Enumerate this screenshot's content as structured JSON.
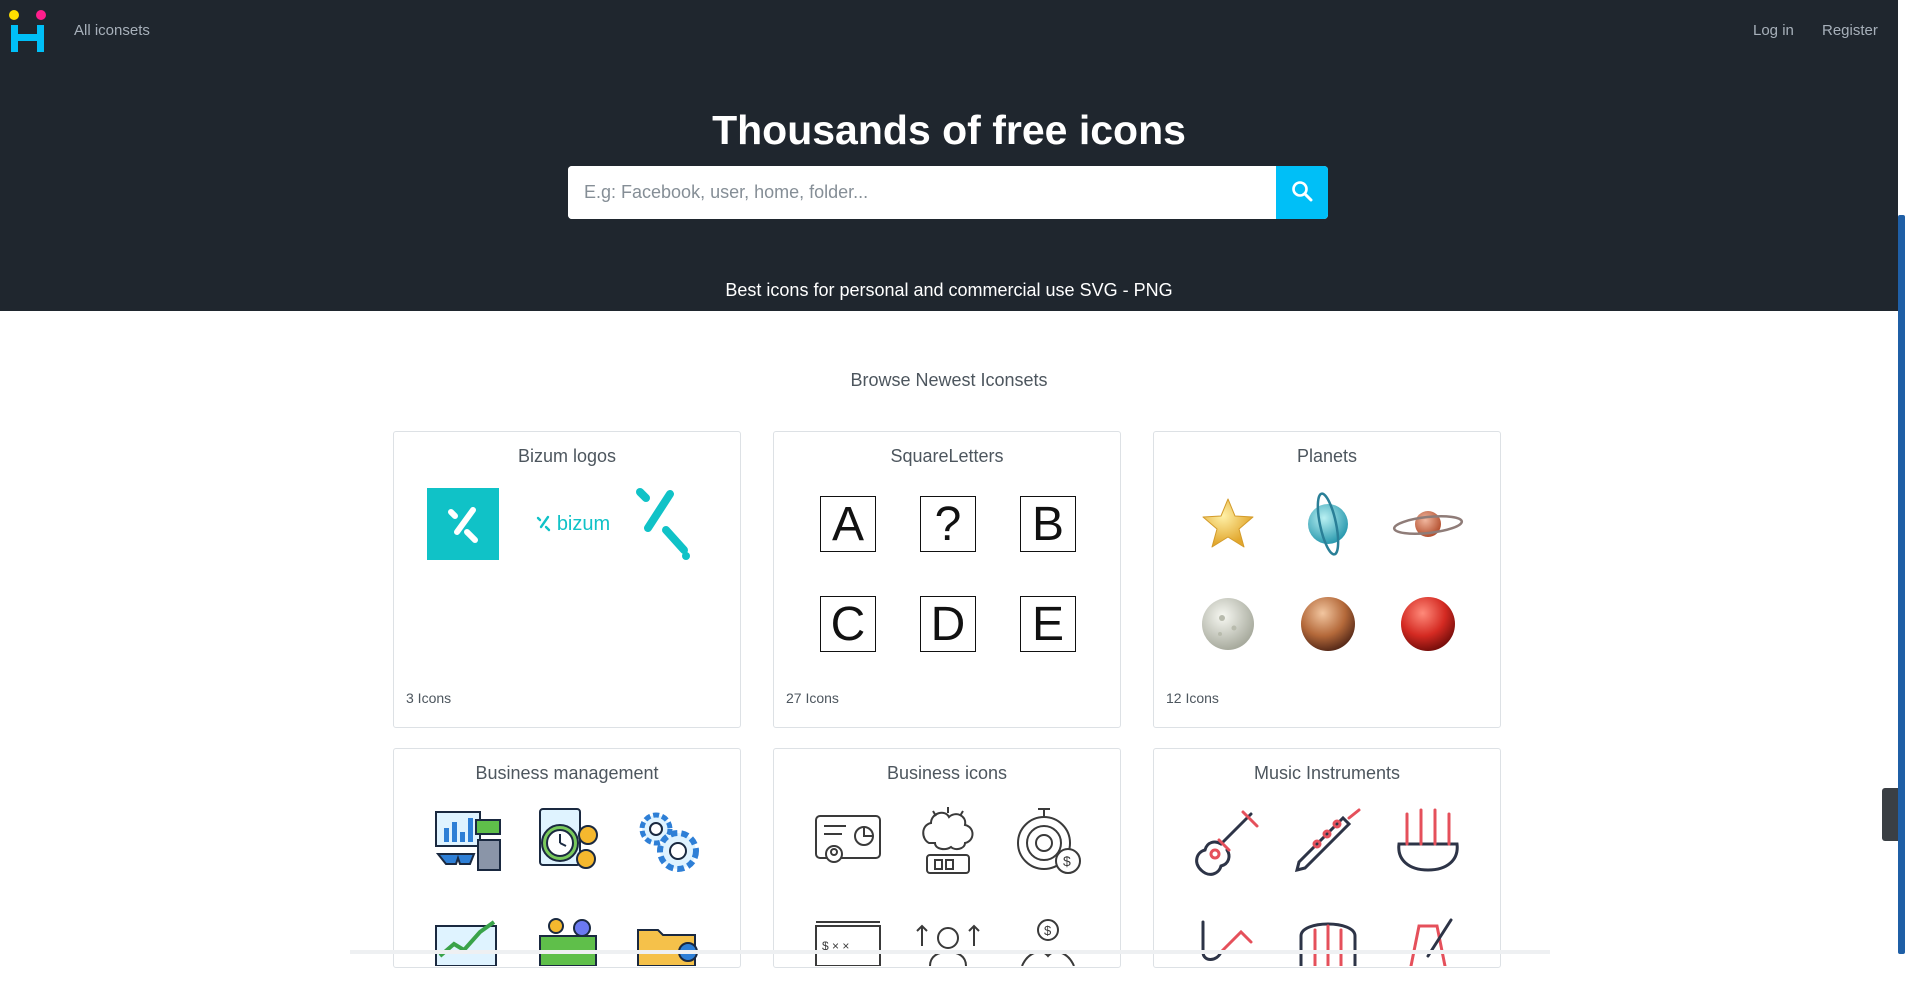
{
  "nav": {
    "all_iconsets": "All iconsets",
    "login": "Log in",
    "register": "Register",
    "logo_icon": "brand-logo-icon"
  },
  "hero": {
    "title": "Thousands of free icons",
    "search_placeholder": "E.g: Facebook, user, home, folder...",
    "search_icon": "search-icon",
    "subtitle": "Best icons for personal and commercial use SVG - PNG"
  },
  "section_title": "Browse Newest Iconsets",
  "iconsets": [
    {
      "title": "Bizum logos",
      "count": "3 Icons",
      "icons": [
        "bizum-square-icon",
        "bizum-wordmark-icon",
        "bizum-mark-icon"
      ],
      "wordmark_text": "bizum"
    },
    {
      "title": "SquareLetters",
      "count": "27 Icons",
      "letters": [
        "A",
        "?",
        "B",
        "C",
        "D",
        "E"
      ]
    },
    {
      "title": "Planets",
      "count": "12 Icons",
      "icons": [
        "star-icon",
        "uranus-icon",
        "saturn-icon",
        "moon-icon",
        "mercury-icon",
        "mars-icon"
      ]
    },
    {
      "title": "Business management",
      "count": "",
      "icons": [
        "finance-desk-icon",
        "clock-coins-icon",
        "gears-icon",
        "growth-chart-icon",
        "payment-card-icon",
        "folder-settings-icon"
      ]
    },
    {
      "title": "Business icons",
      "count": "",
      "icons": [
        "presentation-card-icon",
        "brain-idea-icon",
        "time-money-icon",
        "strategy-board-icon",
        "businessman-growth-icon",
        "money-hand-icon"
      ]
    },
    {
      "title": "Music Instruments",
      "count": "",
      "icons": [
        "guitar-icon",
        "clarinet-icon",
        "bagpipe-icon",
        "saxophone-icon",
        "harp-icon",
        "metronome-icon"
      ]
    }
  ],
  "colors": {
    "header_bg": "#1f262e",
    "accent": "#00bff7",
    "bizum_teal": "#10c2c7",
    "music_red": "#e5505b",
    "music_navy": "#2d3447"
  }
}
